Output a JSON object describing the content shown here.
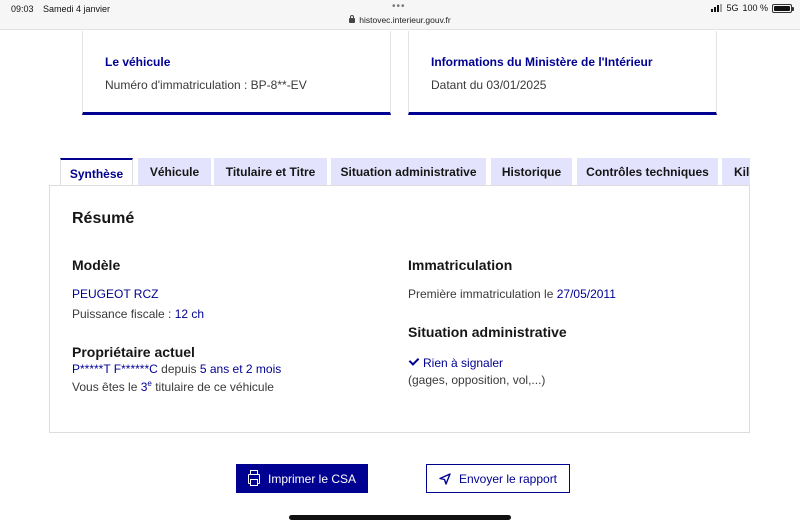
{
  "status_bar": {
    "time": "09:03",
    "date": "Samedi 4 janvier",
    "url": "histovec.interieur.gouv.fr",
    "network": "5G",
    "battery": "100 %",
    "battery_level": 1.0
  },
  "cards": [
    {
      "title": "Le véhicule",
      "text": "Numéro d'immatriculation : BP-8**-EV"
    },
    {
      "title": "Informations du Ministère de l'Intérieur",
      "text": "Datant du 03/01/2025"
    }
  ],
  "tabs": [
    {
      "label": "Synthèse",
      "active": true
    },
    {
      "label": "Véhicule"
    },
    {
      "label": "Titulaire et Titre"
    },
    {
      "label": "Situation administrative"
    },
    {
      "label": "Historique"
    },
    {
      "label": "Contrôles techniques"
    },
    {
      "label": "Kilo"
    }
  ],
  "summary": {
    "heading": "Résumé",
    "model": {
      "heading": "Modèle",
      "name": "PEUGEOT RCZ",
      "power_label": "Puissance fiscale : ",
      "power_value": "12 ch"
    },
    "owner": {
      "heading": "Propriétaire actuel",
      "name": "P*****T F******C",
      "since_label": " depuis ",
      "since_value": "5 ans et 2 mois",
      "rank_prefix": "Vous êtes le ",
      "rank_number": "3",
      "rank_suffix_sup": "e",
      "rank_suffix": " titulaire de ce véhicule"
    },
    "registration": {
      "heading": "Immatriculation",
      "label": "Première immatriculation le ",
      "date": "27/05/2011"
    },
    "admin_situation": {
      "heading": "Situation administrative",
      "status": "Rien à signaler",
      "detail": "(gages, opposition, vol,...)"
    }
  },
  "actions": {
    "print_label": "Imprimer le CSA",
    "send_label": "Envoyer le rapport"
  },
  "colors": {
    "accent": "#000091",
    "tab_bg": "#e3e3fd"
  }
}
